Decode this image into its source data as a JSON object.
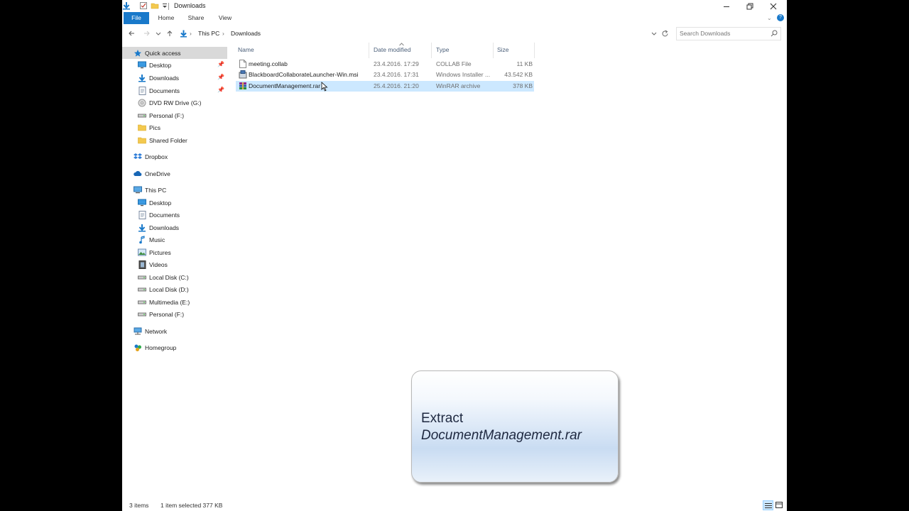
{
  "window": {
    "title": "Downloads",
    "controls": [
      "minimize-icon",
      "restore-icon",
      "close-icon"
    ]
  },
  "ribbon": {
    "tabs": [
      "File",
      "Home",
      "Share",
      "View"
    ]
  },
  "address": {
    "crumbs": [
      "This PC",
      "Downloads"
    ],
    "search_placeholder": "Search Downloads"
  },
  "nav": {
    "quick_access": "Quick access",
    "quick_items": [
      {
        "label": "Desktop",
        "icon": "desktop-icon",
        "pinned": true
      },
      {
        "label": "Downloads",
        "icon": "download-icon",
        "pinned": true
      },
      {
        "label": "Documents",
        "icon": "documents-icon",
        "pinned": true
      },
      {
        "label": "DVD RW Drive (G:)",
        "icon": "dvd-icon",
        "pinned": false
      },
      {
        "label": "Personal (F:)",
        "icon": "drive-icon",
        "pinned": false
      },
      {
        "label": "Pics",
        "icon": "folder-icon",
        "pinned": false
      },
      {
        "label": "Shared Folder",
        "icon": "folder-icon",
        "pinned": false
      }
    ],
    "dropbox": "Dropbox",
    "onedrive": "OneDrive",
    "this_pc": "This PC",
    "pc_items": [
      {
        "label": "Desktop",
        "icon": "desktop-icon"
      },
      {
        "label": "Documents",
        "icon": "documents-icon"
      },
      {
        "label": "Downloads",
        "icon": "download-icon"
      },
      {
        "label": "Music",
        "icon": "music-icon"
      },
      {
        "label": "Pictures",
        "icon": "pictures-icon"
      },
      {
        "label": "Videos",
        "icon": "videos-icon"
      },
      {
        "label": "Local Disk (C:)",
        "icon": "drive-icon"
      },
      {
        "label": "Local Disk (D:)",
        "icon": "drive-icon"
      },
      {
        "label": "Multimedia (E:)",
        "icon": "drive-icon"
      },
      {
        "label": "Personal (F:)",
        "icon": "drive-icon"
      }
    ],
    "network": "Network",
    "homegroup": "Homegroup"
  },
  "columns": {
    "name": "Name",
    "date": "Date modified",
    "type": "Type",
    "size": "Size"
  },
  "files": [
    {
      "name": "meeting.collab",
      "date": "23.4.2016. 17:29",
      "type": "COLLAB File",
      "size": "11 KB",
      "icon": "file-icon",
      "selected": false
    },
    {
      "name": "BlackboardCollaborateLauncher-Win.msi",
      "date": "23.4.2016. 17:31",
      "type": "Windows Installer ...",
      "size": "43.542 KB",
      "icon": "installer-icon",
      "selected": false
    },
    {
      "name": "DocumentManagement.rar",
      "date": "25.4.2016. 21:20",
      "type": "WinRAR archive",
      "size": "378 KB",
      "icon": "winrar-icon",
      "selected": true
    }
  ],
  "callout": {
    "line1": "Extract",
    "line2": "DocumentManagement.rar"
  },
  "status": {
    "items": "3 items",
    "selection": "1 item selected  377 KB"
  }
}
